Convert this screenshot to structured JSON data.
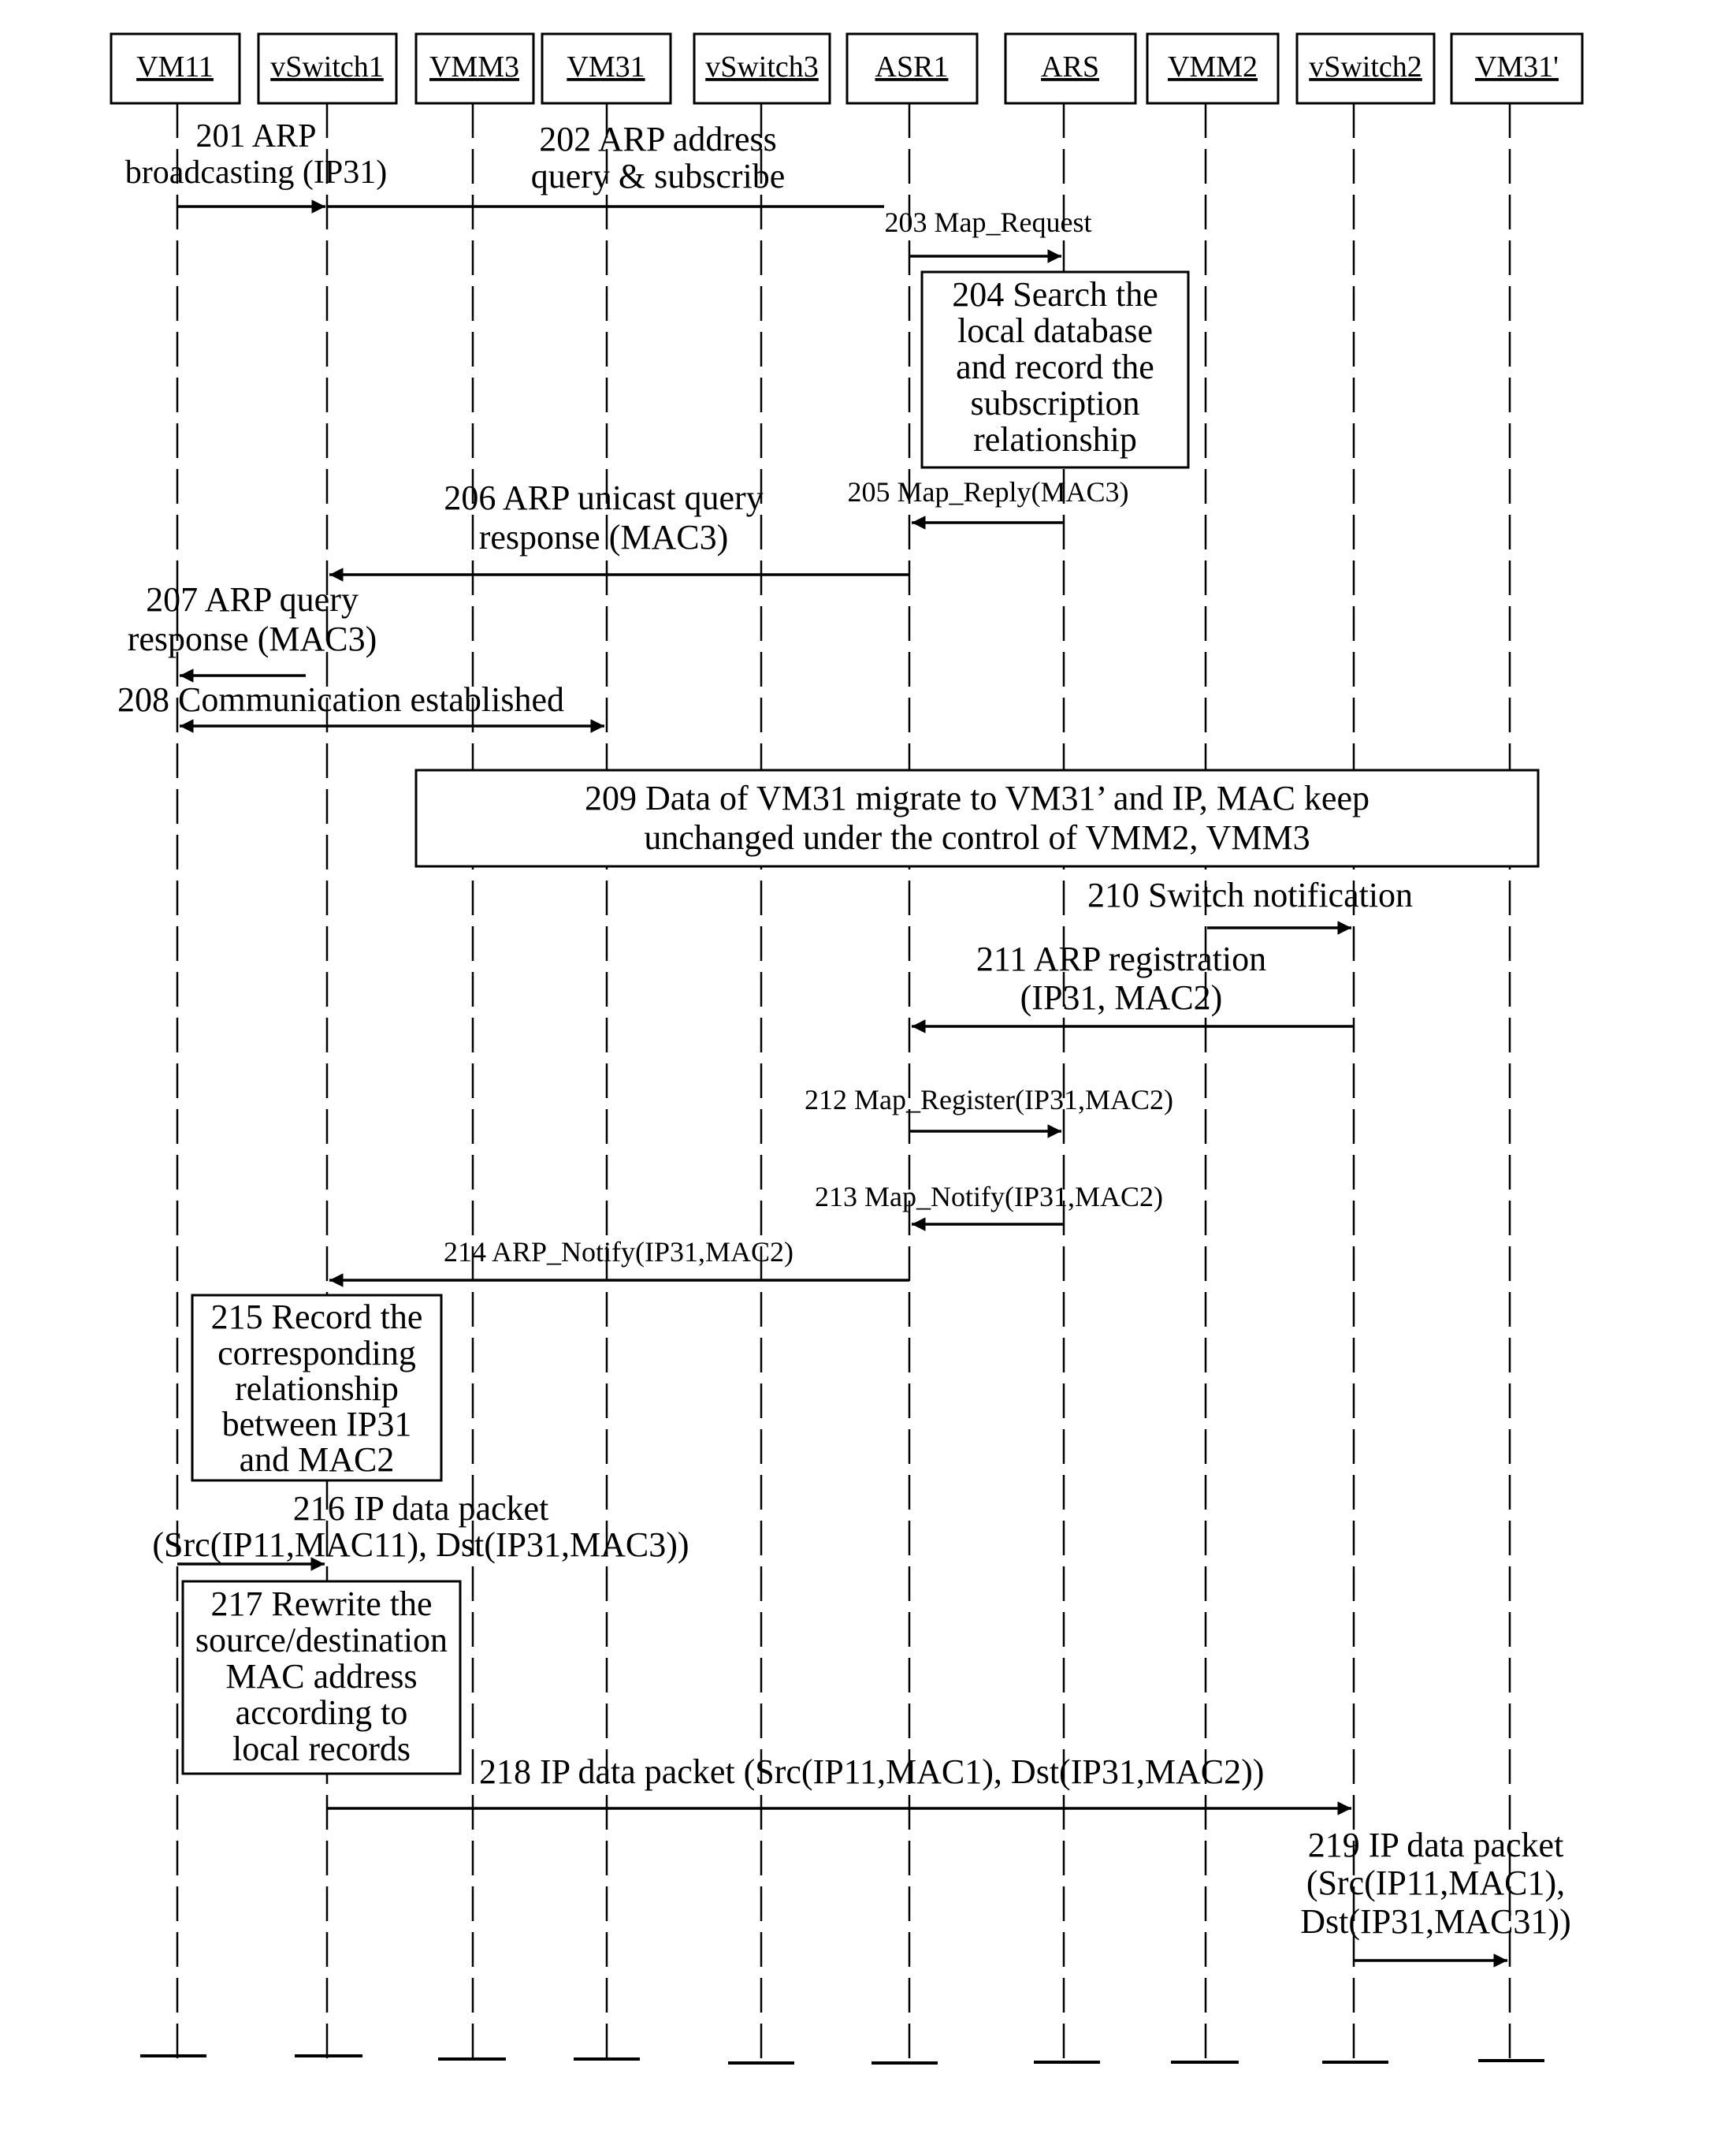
{
  "diagram": {
    "type": "sequence",
    "participants": [
      {
        "id": "vm11",
        "label": "VM11"
      },
      {
        "id": "vswitch1",
        "label": "vSwitch1"
      },
      {
        "id": "vmm3",
        "label": "VMM3"
      },
      {
        "id": "vm31",
        "label": "VM31"
      },
      {
        "id": "vswitch3",
        "label": "vSwitch3"
      },
      {
        "id": "asr1",
        "label": "ASR1"
      },
      {
        "id": "ars",
        "label": "ARS"
      },
      {
        "id": "vmm2",
        "label": "VMM2"
      },
      {
        "id": "vswitch2",
        "label": "vSwitch2"
      },
      {
        "id": "vm31p",
        "label": "VM31'"
      }
    ],
    "messages": [
      {
        "step": "201",
        "from": "vm11",
        "to": "vswitch1",
        "lines": [
          "201 ARP",
          "broadcasting (IP31)"
        ]
      },
      {
        "step": "202",
        "from": "vswitch1",
        "to": "asr1",
        "lines": [
          "202 ARP address",
          "query & subscribe"
        ]
      },
      {
        "step": "203",
        "from": "asr1",
        "to": "ars",
        "lines": [
          "203 Map_Request"
        ]
      },
      {
        "step": "205",
        "from": "ars",
        "to": "asr1",
        "lines": [
          "205 Map_Reply(MAC3)"
        ]
      },
      {
        "step": "206",
        "from": "asr1",
        "to": "vswitch1",
        "lines": [
          "206 ARP unicast query",
          "response (MAC3)"
        ]
      },
      {
        "step": "207",
        "from": "vswitch1",
        "to": "vm11",
        "lines": [
          "207 ARP query",
          "response (MAC3)"
        ]
      },
      {
        "step": "208",
        "from": "vm11",
        "to": "vm31",
        "bidirectional": true,
        "lines": [
          "208 Communication established"
        ]
      },
      {
        "step": "210",
        "from": "vmm2",
        "to": "vswitch2",
        "lines": [
          "210 Switch notification"
        ]
      },
      {
        "step": "211",
        "from": "vswitch2",
        "to": "asr1",
        "lines": [
          "211 ARP registration",
          "(IP31, MAC2)"
        ]
      },
      {
        "step": "212",
        "from": "asr1",
        "to": "ars",
        "lines": [
          "212 Map_Register(IP31,MAC2)"
        ]
      },
      {
        "step": "213",
        "from": "ars",
        "to": "asr1",
        "lines": [
          "213 Map_Notify(IP31,MAC2)"
        ]
      },
      {
        "step": "214",
        "from": "asr1",
        "to": "vswitch1",
        "lines": [
          "214 ARP_Notify(IP31,MAC2)"
        ]
      },
      {
        "step": "216",
        "from": "vm11",
        "to": "vswitch1",
        "lines": [
          "216 IP data packet",
          "(Src(IP11,MAC11), Dst(IP31,MAC3))"
        ]
      },
      {
        "step": "218",
        "from": "vswitch1",
        "to": "vswitch2",
        "lines": [
          "218 IP data packet (Src(IP11,MAC1), Dst(IP31,MAC2))"
        ]
      },
      {
        "step": "219",
        "from": "vswitch2",
        "to": "vm31p",
        "lines": [
          "219 IP data packet",
          "(Src(IP11,MAC1),",
          "Dst(IP31,MAC31))"
        ]
      }
    ],
    "notes": [
      {
        "step": "204",
        "lines": [
          "204 Search the",
          "local database",
          "and record the",
          "subscription",
          "relationship"
        ]
      },
      {
        "step": "209",
        "lines": [
          "209 Data of VM31 migrate to VM31’ and IP, MAC keep",
          "unchanged under the control of VMM2, VMM3"
        ]
      },
      {
        "step": "215",
        "lines": [
          "215 Record the",
          "corresponding",
          "relationship",
          "between IP31",
          "and MAC2"
        ]
      },
      {
        "step": "217",
        "lines": [
          "217 Rewrite the",
          "source/destination",
          "MAC address",
          "according to",
          "local records"
        ]
      }
    ]
  }
}
